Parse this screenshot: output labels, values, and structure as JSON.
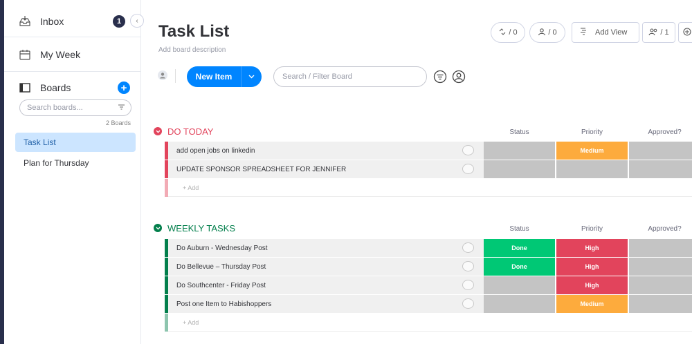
{
  "sidebar": {
    "inbox_label": "Inbox",
    "inbox_count": "1",
    "collapse_glyph": "‹",
    "myweek_label": "My Week",
    "boards_label": "Boards",
    "add_glyph": "+",
    "search_placeholder": "Search boards...",
    "boards_count": "2 Boards",
    "boards": [
      {
        "label": "Task List",
        "active": true
      },
      {
        "label": "Plan for Thursday",
        "active": false
      }
    ]
  },
  "board": {
    "title": "Task List",
    "description": "Add board description"
  },
  "toolbar": {
    "activity_count": "/ 0",
    "updates_count": "/ 0",
    "add_view_label": "Add View",
    "members_count": "/ 1"
  },
  "controls": {
    "new_item_label": "New Item",
    "filter_placeholder": "Search / Filter Board"
  },
  "columns": {
    "status": "Status",
    "priority": "Priority",
    "approved": "Approved?"
  },
  "add_label": "+ Add",
  "colors": {
    "done": "#00c875",
    "high": "#e2445c",
    "medium": "#fdab3d",
    "empty": "#c4c4c4",
    "group_red": "#e2445c",
    "group_green": "#037f4c",
    "primary": "#0085ff"
  },
  "groups": [
    {
      "name": "DO TODAY",
      "color": "#e2445c",
      "rows": [
        {
          "name": "add open jobs on linkedin",
          "status": "",
          "priority": "Medium",
          "approved": ""
        },
        {
          "name": "UPDATE SPONSOR SPREADSHEET FOR JENNIFER",
          "status": "",
          "priority": "",
          "approved": ""
        }
      ]
    },
    {
      "name": "WEEKLY TASKS",
      "color": "#037f4c",
      "rows": [
        {
          "name": "Do Auburn - Wednesday Post",
          "status": "Done",
          "priority": "High",
          "approved": ""
        },
        {
          "name": "Do Bellevue – Thursday Post",
          "status": "Done",
          "priority": "High",
          "approved": ""
        },
        {
          "name": "Do Southcenter - Friday Post",
          "status": "",
          "priority": "High",
          "approved": ""
        },
        {
          "name": "Post one Item to Habishoppers",
          "status": "",
          "priority": "Medium",
          "approved": ""
        }
      ]
    }
  ]
}
